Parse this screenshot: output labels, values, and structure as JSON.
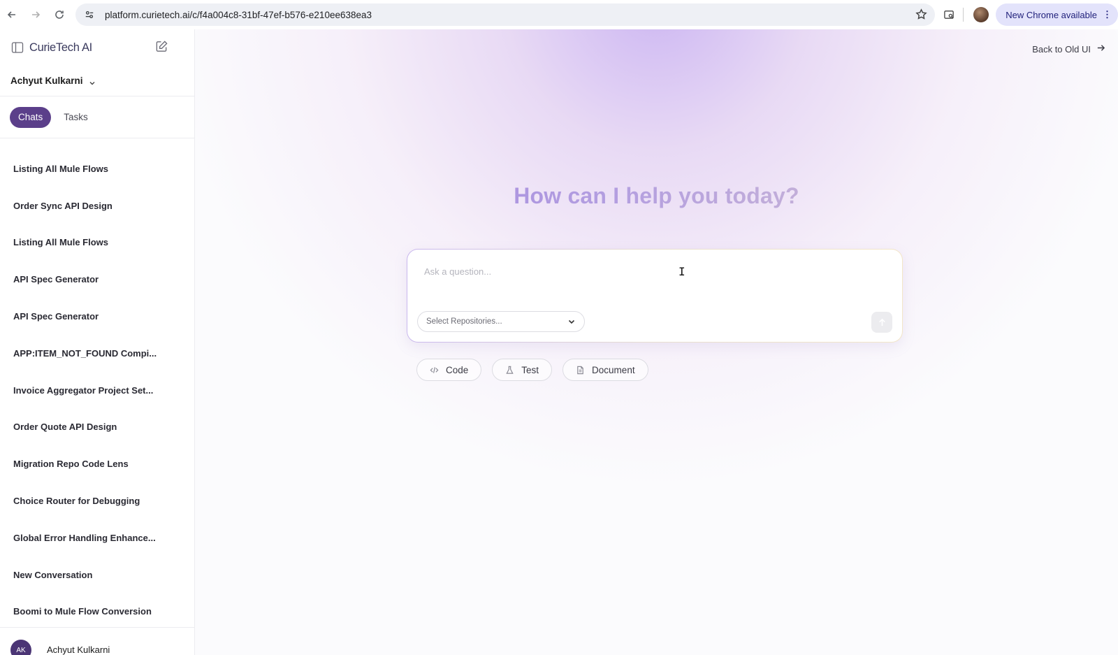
{
  "browser": {
    "url": "platform.curietech.ai/c/f4a004c8-31bf-47ef-b576-e210ee638ea3",
    "update_label": "New Chrome available",
    "icons": [
      "back-arrow-icon",
      "forward-arrow-icon",
      "reload-icon",
      "site-info-icon",
      "star-icon",
      "tab-search-icon",
      "profile-avatar",
      "more-vert-icon"
    ]
  },
  "sidebar": {
    "brand": "CurieTech AI",
    "user_name": "Achyut Kulkarni",
    "tabs": [
      {
        "label": "Chats",
        "active": true
      },
      {
        "label": "Tasks",
        "active": false
      }
    ],
    "chats": [
      "Listing All Mule Flows",
      "Order Sync API Design",
      "Listing All Mule Flows",
      "API Spec Generator",
      "API Spec Generator",
      "APP:ITEM_NOT_FOUND Compi...",
      "Invoice Aggregator Project Set...",
      "Order Quote API Design",
      "Migration Repo Code Lens",
      "Choice Router for Debugging",
      "Global Error Handling Enhance...",
      "New Conversation",
      "Boomi to Mule Flow Conversion"
    ],
    "footer": {
      "initials": "AK",
      "name": "Achyut Kulkarni"
    }
  },
  "main": {
    "back_link": "Back to Old UI",
    "headline": "How can I help you today?",
    "composer": {
      "placeholder": "Ask a question...",
      "repo_placeholder": "Select Repositories..."
    },
    "actions": [
      {
        "label": "Code",
        "icon": "code-icon"
      },
      {
        "label": "Test",
        "icon": "flask-icon"
      },
      {
        "label": "Document",
        "icon": "document-icon"
      }
    ]
  },
  "colors": {
    "accent": "#5b3f8a",
    "headline_gradient_start": "#9b7fe0",
    "headline_gradient_end": "#b9d9ec"
  }
}
